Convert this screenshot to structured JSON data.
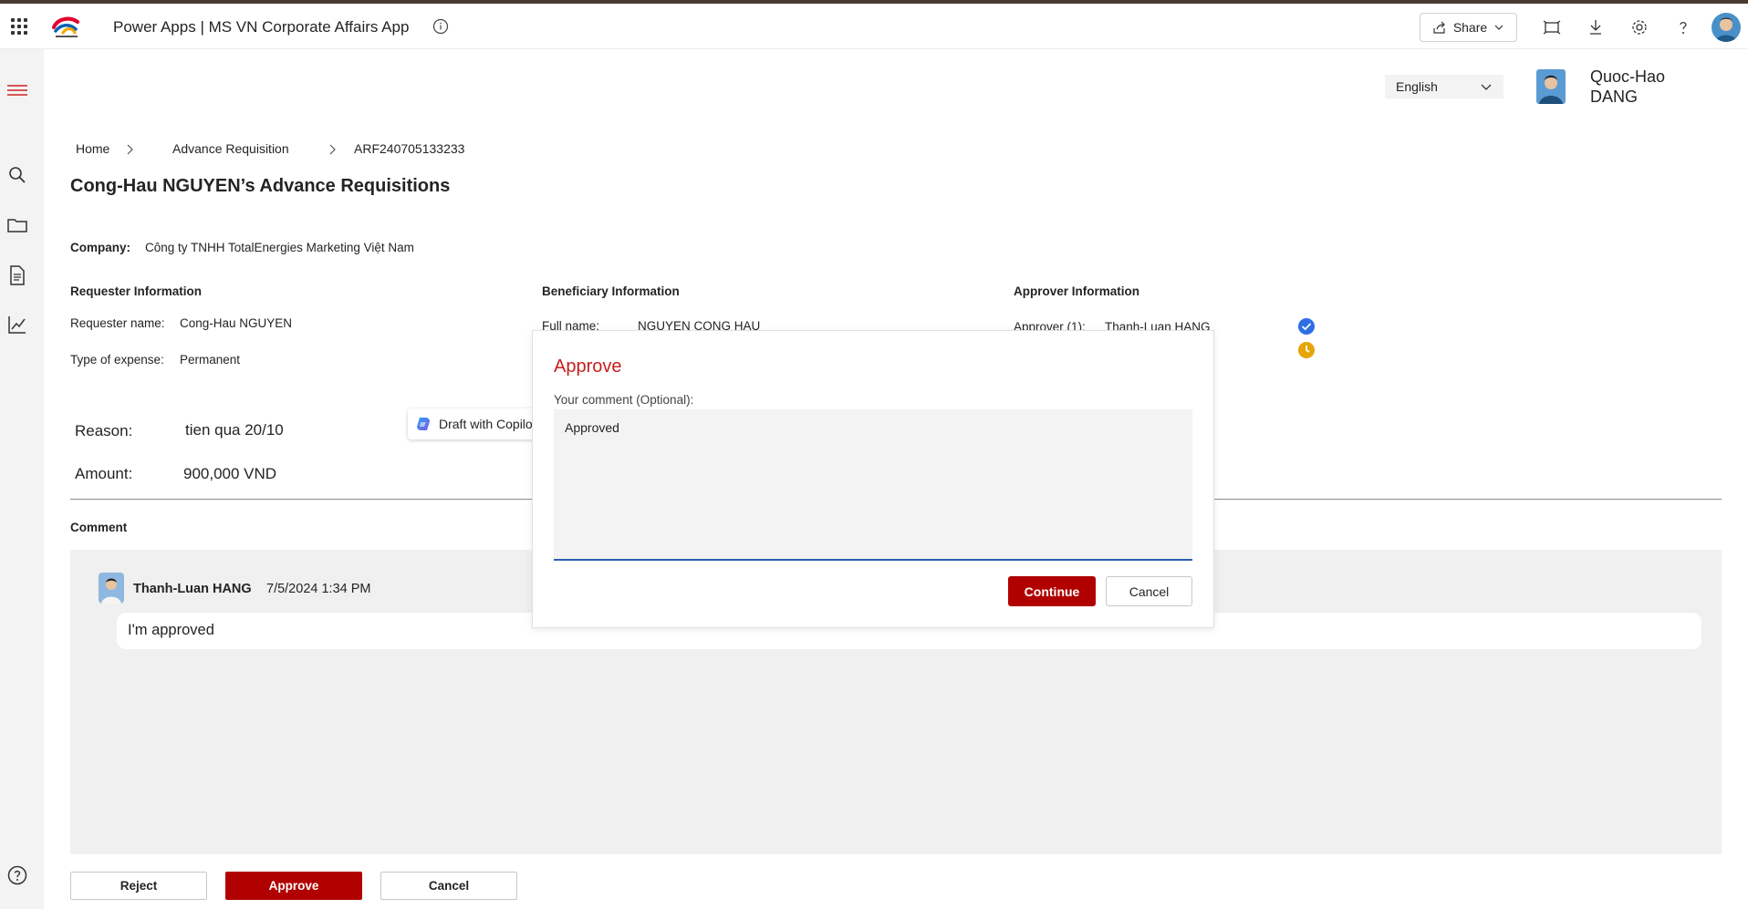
{
  "topbar": {
    "app_title": "Power Apps  |  MS VN Corporate Affairs App",
    "share_label": "Share",
    "icons": [
      "waffle-icon",
      "totalenergies-logo",
      "info-icon",
      "share-icon",
      "chevron-down-icon",
      "fit-screen-icon",
      "download-icon",
      "settings-icon",
      "help-icon",
      "user-avatar"
    ]
  },
  "sidebar": {
    "icons": [
      "hamburger-menu-icon",
      "search-icon",
      "folder-icon",
      "document-icon",
      "chart-icon",
      "help-icon"
    ]
  },
  "header": {
    "language": "English",
    "user_name": "Quoc-Hao DANG"
  },
  "breadcrumb": {
    "home": "Home",
    "section": "Advance Requisition",
    "current": "ARF240705133233"
  },
  "page_title": "Cong-Hau NGUYEN’s Advance Requisitions",
  "company": {
    "label": "Company:",
    "value": "Công ty TNHH TotalEnergies Marketing Việt Nam"
  },
  "requester": {
    "heading": "Requester Information",
    "name_label": "Requester name:",
    "name_value": "Cong-Hau NGUYEN",
    "expense_label": "Type of expense:",
    "expense_value": "Permanent"
  },
  "beneficiary": {
    "heading": "Beneficiary Information",
    "fullname_label": "Full name:",
    "fullname_value": "NGUYEN CONG HAU"
  },
  "approver": {
    "heading": "Approver Information",
    "approver1_label": "Approver (1):",
    "approver1_value": "Thanh-Luan HANG"
  },
  "reason": {
    "label": "Reason:",
    "value": "tien qua 20/10"
  },
  "amount": {
    "label": "Amount:",
    "value": "900,000 VND"
  },
  "comment_section": {
    "heading": "Comment",
    "author": "Thanh-Luan HANG",
    "timestamp": "7/5/2024 1:34 PM",
    "text": "I'm approved"
  },
  "copilot_button": "Draft with Copilot",
  "dialog": {
    "title": "Approve",
    "comment_label": "Your comment (Optional):",
    "comment_value": "Approved",
    "continue_label": "Continue",
    "cancel_label": "Cancel"
  },
  "footer": {
    "reject_label": "Reject",
    "approve_label": "Approve",
    "cancel_label": "Cancel"
  },
  "colors": {
    "accent_red": "#b10000",
    "dialog_title_red": "#c81e1e",
    "check_blue": "#2f6fe4",
    "pending_gold": "#e5a50a"
  }
}
